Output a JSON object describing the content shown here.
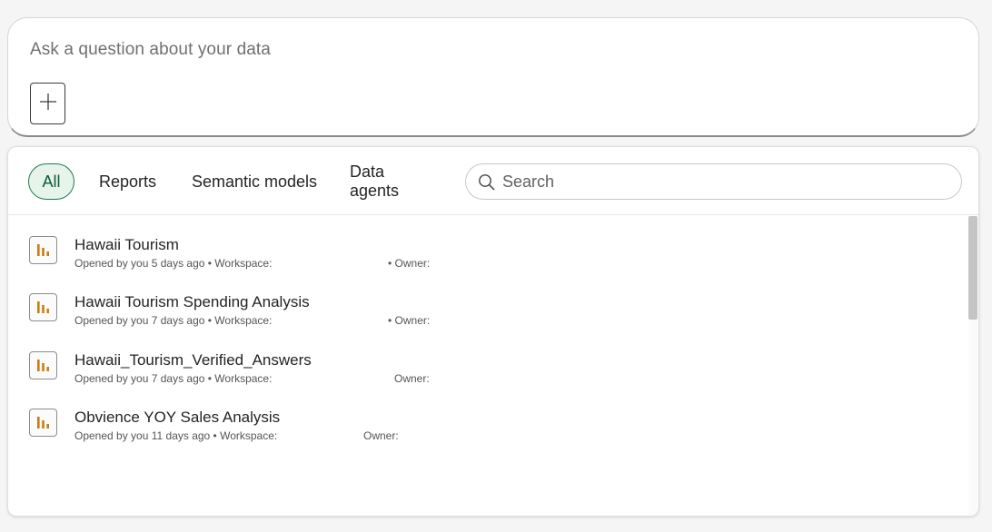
{
  "ask": {
    "placeholder": "Ask a question about your data",
    "add_icon": "plus-icon"
  },
  "filters": {
    "chips": [
      {
        "label": "All",
        "active": true
      },
      {
        "label": "Reports",
        "active": false
      },
      {
        "label": "Semantic models",
        "active": false
      },
      {
        "label": "Data agents",
        "active": false
      }
    ],
    "search_placeholder": "Search",
    "search_icon": "search-icon"
  },
  "items": [
    {
      "title": "Hawaii Tourism",
      "meta": "Opened by you 5 days ago • Workspace:",
      "owner": "• Owner:",
      "icon": "report-icon"
    },
    {
      "title": "Hawaii Tourism Spending Analysis",
      "meta": "Opened by you 7 days ago • Workspace:",
      "owner": "• Owner:",
      "icon": "report-icon"
    },
    {
      "title": "Hawaii_Tourism_Verified_Answers",
      "meta": "Opened by you 7 days ago • Workspace:",
      "owner": "Owner:",
      "icon": "report-icon"
    },
    {
      "title": "Obvience YOY Sales Analysis",
      "meta": "Opened by you 11 days ago • Workspace:",
      "owner": "Owner:",
      "icon": "report-icon"
    }
  ],
  "colors": {
    "accent_green": "#1f7a4c",
    "report_icon": "#c77d13"
  }
}
